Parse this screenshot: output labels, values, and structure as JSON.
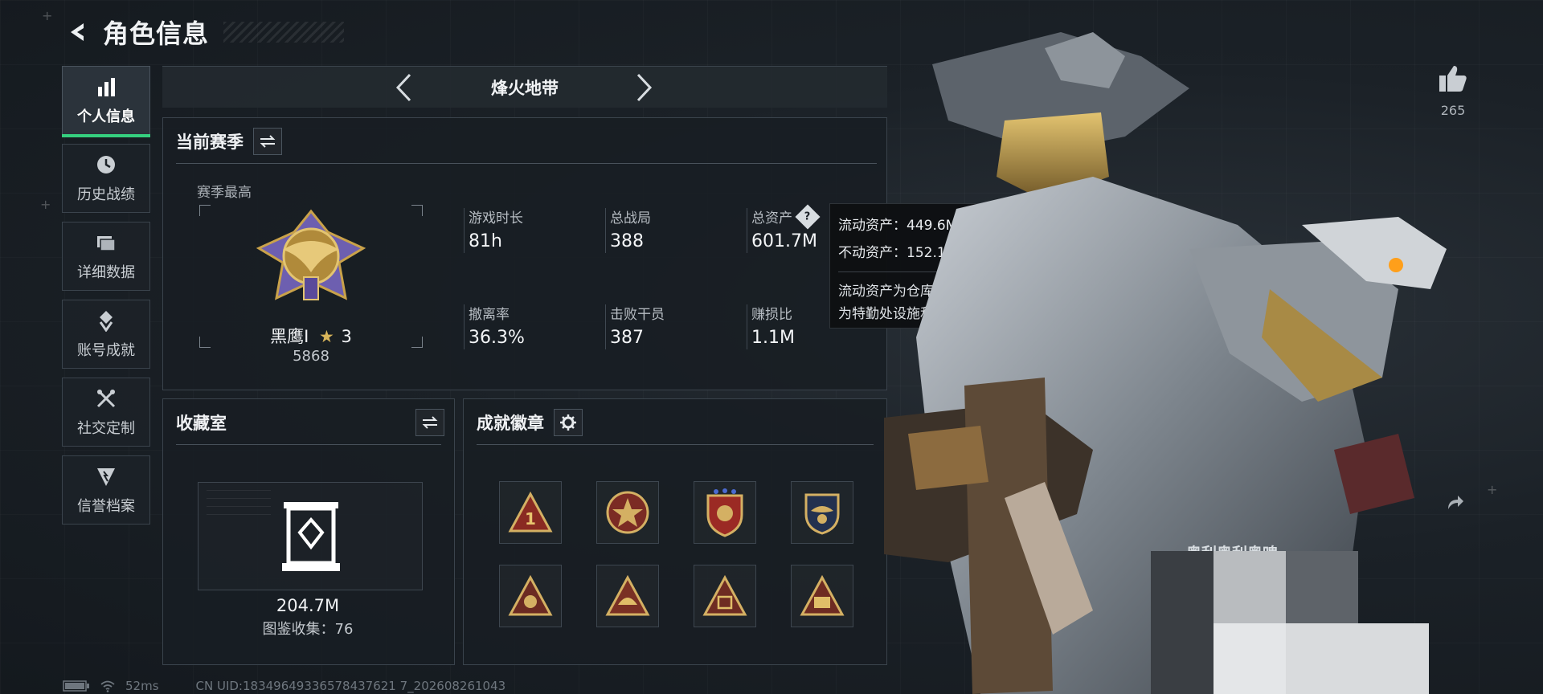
{
  "header": {
    "title": "角色信息"
  },
  "sidebar": {
    "items": [
      {
        "label": "个人信息",
        "icon": "bar-chart-icon",
        "active": true
      },
      {
        "label": "历史战绩",
        "icon": "clock-icon",
        "active": false
      },
      {
        "label": "详细数据",
        "icon": "folder-icon",
        "active": false
      },
      {
        "label": "账号成就",
        "icon": "achievement-icon",
        "active": false
      },
      {
        "label": "社交定制",
        "icon": "tools-icon",
        "active": false
      },
      {
        "label": "信誉档案",
        "icon": "shield-icon",
        "active": false
      }
    ]
  },
  "mode": {
    "title": "烽火地带"
  },
  "season": {
    "title": "当前赛季",
    "best_label": "赛季最高",
    "rank_name": "黑鹰Ⅰ",
    "rank_stars": "3",
    "rank_score": "5868",
    "stats": [
      {
        "label": "游戏时长",
        "value": "81h"
      },
      {
        "label": "总战局",
        "value": "388"
      },
      {
        "label": "总资产",
        "value": "601.7M"
      },
      {
        "label": "撤离率",
        "value": "36.3%"
      },
      {
        "label": "击败干员",
        "value": "387"
      },
      {
        "label": "赚损比",
        "value": "1.1M"
      }
    ]
  },
  "tooltip": {
    "liquid": "流动资产：449.6M",
    "fixed": "不动资产：152.1M",
    "desc1": "流动资产为仓库资产和哈夫币，不动资产",
    "desc2": "为特勤处设施和收藏室设施"
  },
  "collection": {
    "title": "收藏室",
    "value": "204.7M",
    "count_label": "图鉴收集：76"
  },
  "achievements": {
    "title": "成就徽章"
  },
  "profile": {
    "likes": "265",
    "character_name": "奥利奥利奥啤"
  },
  "footer": {
    "ping": "52ms",
    "uid": "CN UID:18349649336578437621 7_202608261043"
  },
  "colors": {
    "accent": "#35d07f",
    "gold": "#c9a24a",
    "panel": "#181e23"
  }
}
